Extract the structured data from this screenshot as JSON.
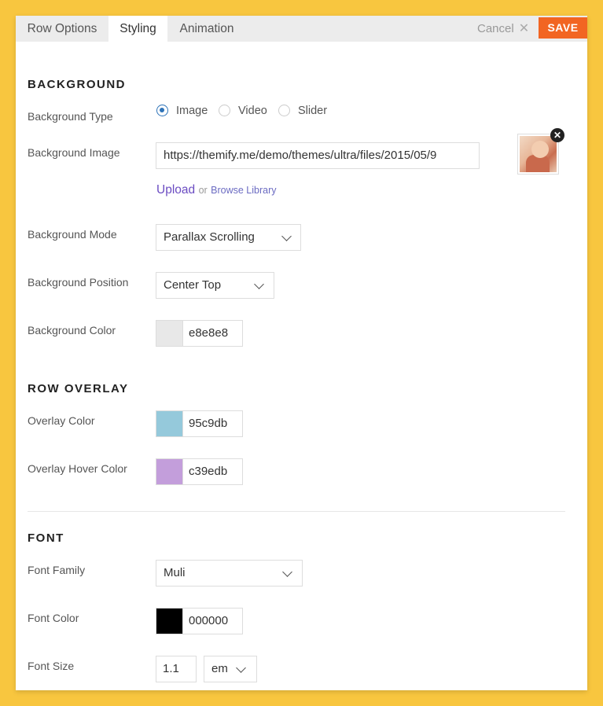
{
  "tabs": [
    {
      "label": "Row Options"
    },
    {
      "label": "Styling"
    },
    {
      "label": "Animation"
    }
  ],
  "header": {
    "cancel_label": "Cancel",
    "save_label": "SAVE"
  },
  "background": {
    "section_title": "BACKGROUND",
    "type_label": "Background Type",
    "type_options": [
      "Image",
      "Video",
      "Slider"
    ],
    "type_selected": "Image",
    "image_label": "Background Image",
    "image_url": "https://themify.me/demo/themes/ultra/files/2015/05/9",
    "upload_label": "Upload",
    "or_text": "or",
    "browse_label": "Browse Library",
    "mode_label": "Background Mode",
    "mode_value": "Parallax Scrolling",
    "position_label": "Background Position",
    "position_value": "Center Top",
    "color_label": "Background Color",
    "color_value": "e8e8e8",
    "color_hex": "#e8e8e8"
  },
  "overlay": {
    "section_title": "ROW OVERLAY",
    "color_label": "Overlay Color",
    "color_value": "95c9db",
    "color_hex": "#95c9db",
    "hover_label": "Overlay Hover Color",
    "hover_value": "c39edb",
    "hover_hex": "#c39edb"
  },
  "font": {
    "section_title": "FONT",
    "family_label": "Font Family",
    "family_value": "Muli",
    "color_label": "Font Color",
    "color_value": "000000",
    "color_hex": "#000000",
    "size_label": "Font Size",
    "size_value": "1.1",
    "size_unit": "em"
  },
  "colors": {
    "accent": "#f26522",
    "frame": "#f8c63f",
    "link": "#6b4cc2"
  }
}
